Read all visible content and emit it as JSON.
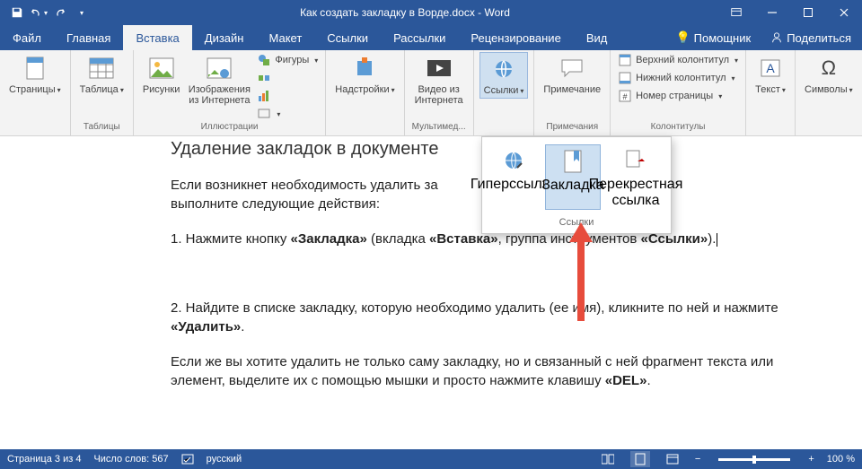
{
  "titlebar": {
    "doc_title": "Как создать закладку в Ворде.docx  -  Word"
  },
  "tabs": {
    "file": "Файл",
    "home": "Главная",
    "insert": "Вставка",
    "design": "Дизайн",
    "layout": "Макет",
    "references": "Ссылки",
    "mailings": "Рассылки",
    "review": "Рецензирование",
    "view": "Вид",
    "tellme": "Помощник",
    "share": "Поделиться"
  },
  "ribbon": {
    "pages": {
      "pages_btn": "Страницы",
      "label": ""
    },
    "tables": {
      "table_btn": "Таблица",
      "label": "Таблицы"
    },
    "illus": {
      "pictures": "Рисунки",
      "online": "Изображения из Интернета",
      "shapes": "Фигуры",
      "label": "Иллюстрации"
    },
    "addins": {
      "btn": "Надстройки",
      "label": ""
    },
    "media": {
      "btn": "Видео из Интернета",
      "label": "Мультимед..."
    },
    "links": {
      "btn": "Ссылки"
    },
    "comments": {
      "btn": "Примечание",
      "label": "Примечания"
    },
    "header": {
      "h": "Верхний колонтитул",
      "f": "Нижний колонтитул",
      "n": "Номер страницы",
      "label": "Колонтитулы"
    },
    "text": {
      "btn": "Текст"
    },
    "symbols": {
      "btn": "Символы"
    }
  },
  "popup": {
    "hyperlink": "Гиперссылка",
    "bookmark": "Закладка",
    "crossref": "Перекрестная ссылка",
    "label": "Ссылки"
  },
  "document": {
    "heading": "Удаление закладок в документе",
    "p1a": "Если возникнет необходимость удалить за",
    "p1b": "выполните следующие действия:",
    "p2a": "1. Нажмите кнопку ",
    "p2b": "«Закладка»",
    "p2c": " (вкладка ",
    "p2d": "«Вставка»",
    "p2e": ", группа инструментов ",
    "p2f": "«Ссылки»",
    "p2g": ").",
    "p3a": "2. Найдите в списке закладку, которую необходимо удалить (ее имя), кликните по ней и нажмите ",
    "p3b": "«Удалить»",
    "p3c": ".",
    "p4a": "Если же вы хотите удалить не только саму закладку, но и связанный с ней фрагмент текста или элемент, выделите их с помощью мышки и просто нажмите клавишу ",
    "p4b": "«DEL»",
    "p4c": "."
  },
  "status": {
    "page": "Страница 3 из 4",
    "words": "Число слов: 567",
    "lang": "русский",
    "zoom": "100 %"
  }
}
